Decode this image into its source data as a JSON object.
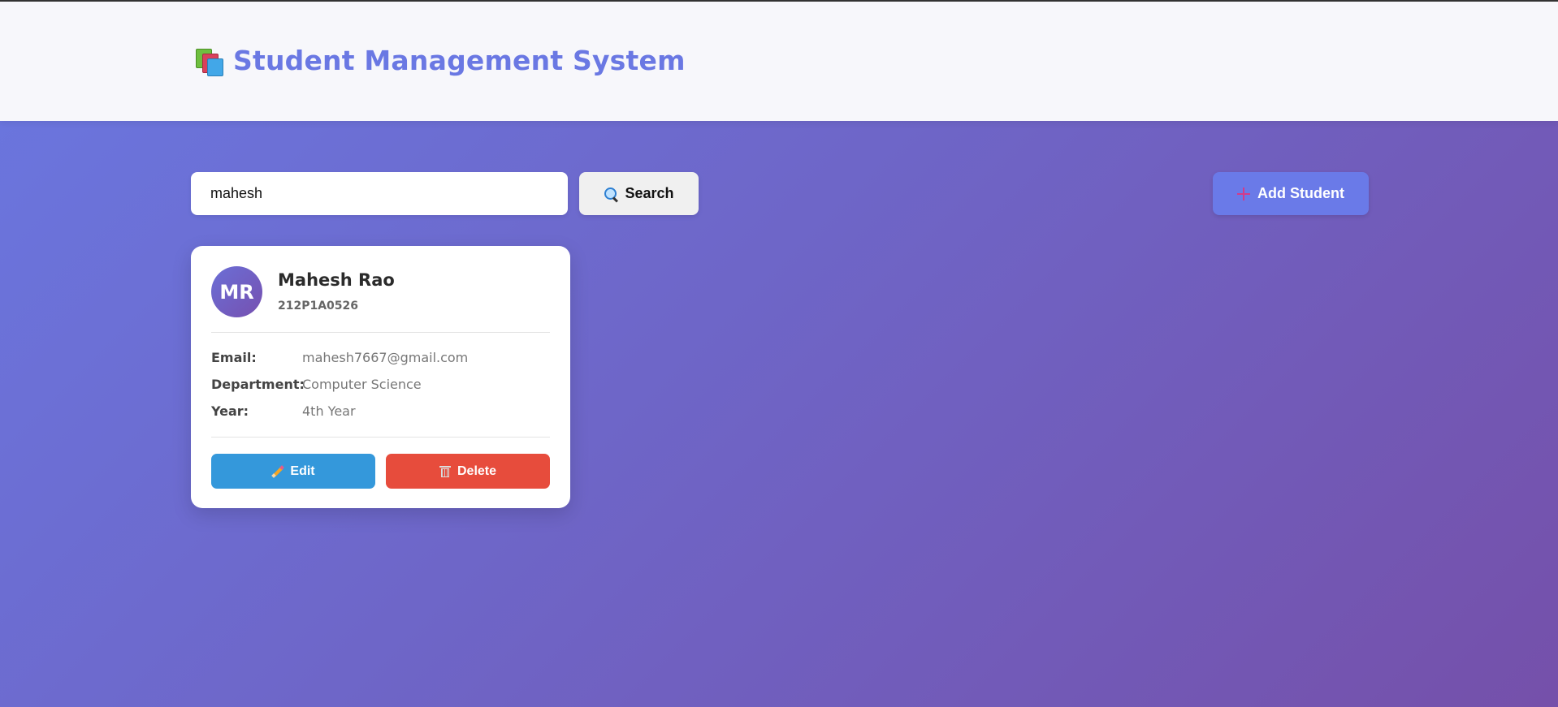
{
  "header": {
    "title": "Student Management System",
    "logo_icon": "books-icon",
    "accent_color": "#6a78e3"
  },
  "toolbar": {
    "search_value": "mahesh",
    "search_button_label": "Search",
    "search_icon": "magnifier-icon",
    "add_button_label": "Add Student",
    "add_icon": "plus-icon"
  },
  "students": [
    {
      "initials": "MR",
      "name": "Mahesh Rao",
      "id": "212P1A0526",
      "fields": [
        {
          "label": "Email:",
          "value": "mahesh7667@gmail.com"
        },
        {
          "label": "Department:",
          "value": "Computer Science"
        },
        {
          "label": "Year:",
          "value": "4th Year"
        }
      ],
      "edit_label": "Edit",
      "delete_label": "Delete"
    }
  ],
  "colors": {
    "edit": "#3498db",
    "delete": "#e74c3c",
    "add": "#6a7ae8"
  }
}
